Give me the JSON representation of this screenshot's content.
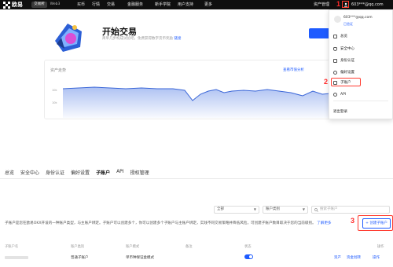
{
  "topnav": {
    "logo_text": "欧易",
    "mode_tabs": [
      "交易所",
      "Web3"
    ],
    "items": [
      "买币",
      "行情",
      "交易",
      "金融服务",
      "新手学院",
      "用户支持",
      "更多"
    ],
    "asset_management": "资产管理",
    "email": "603***@qq.com"
  },
  "banner": {
    "title": "开始交易",
    "subtitle": "简单几步构成试验吧，免费获得数字货币奖励",
    "subtitle_link": "链接"
  },
  "chart_card": {
    "title": "资产走势",
    "link": "查看市值分析",
    "ytick_top": "10k",
    "ytick_bottom": "10k"
  },
  "dropdown": {
    "email": "603***@qq.com",
    "verify": "已验证",
    "items": [
      "总览",
      "安全中心",
      "身份认证",
      "偏好设置",
      "子账户",
      "API",
      "退出登录"
    ]
  },
  "steps": [
    "1",
    "2",
    "3"
  ],
  "tabs": [
    "总览",
    "安全中心",
    "身份认证",
    "偏好设置",
    "子账户",
    "API",
    "授权管理"
  ],
  "filters": {
    "status": "全部",
    "type": "账户类别",
    "search_placeholder": "搜索子账户"
  },
  "description": {
    "text": "子账户是您在欧易OKX开设的一种账户类型，与主账户绑定。子账户可以创建多个，你可以创建多个子账户与主账户绑定，实践不同交易策略并降低风险，可创建子账户数目取决于您的当前级别。",
    "link": "了解更多"
  },
  "create_button": "+ 创建子账户",
  "table": {
    "headers": [
      "子账户名",
      "账户类别",
      "账户模式",
      "备注",
      "状态",
      "操作"
    ],
    "row": {
      "account_type": "普通子账户",
      "mode": "单币种保证金模式",
      "actions": [
        "资产",
        "资金划转",
        "操作"
      ]
    }
  }
}
